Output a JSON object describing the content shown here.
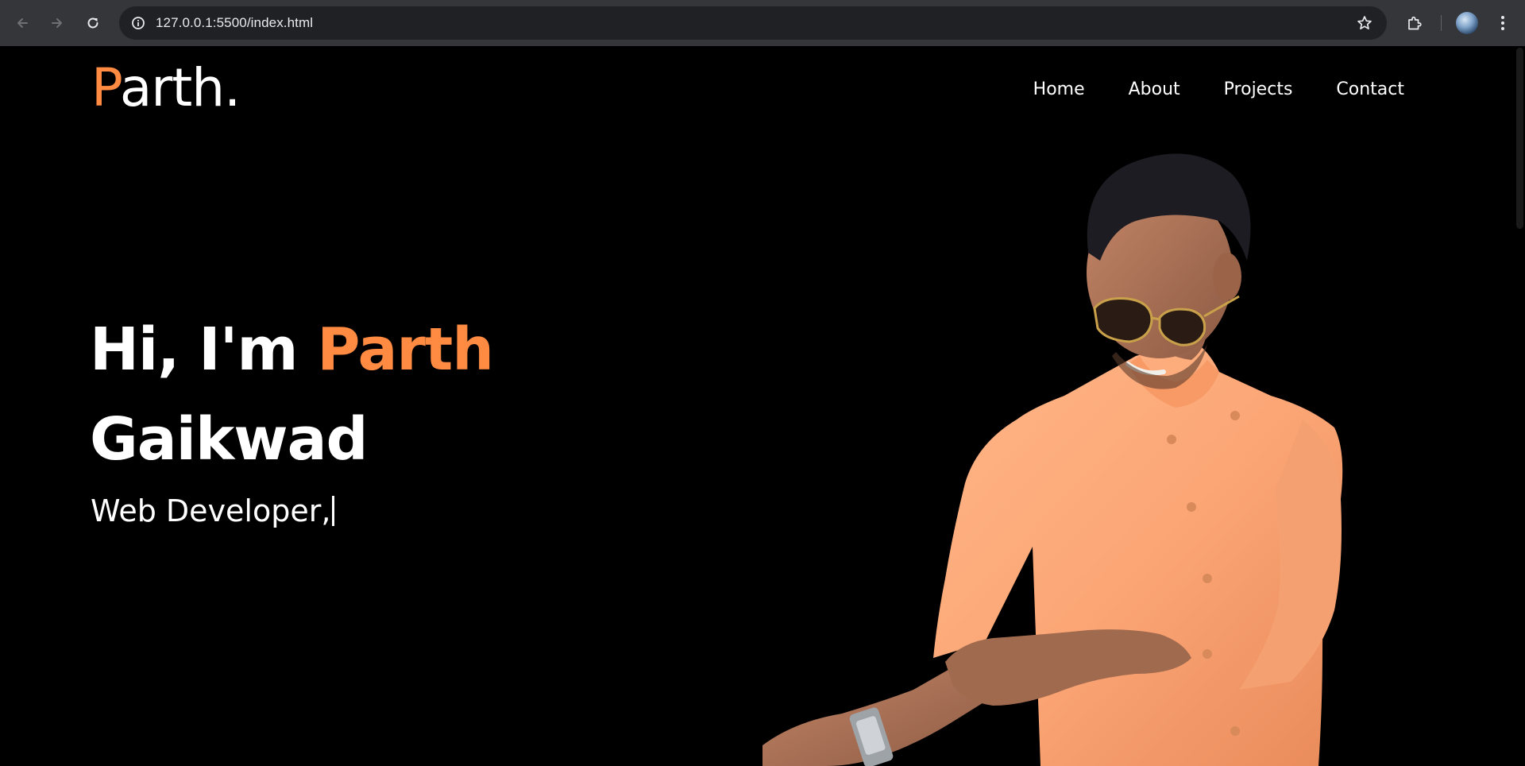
{
  "browser": {
    "url": "127.0.0.1:5500/index.html",
    "icons": {
      "back": "arrow-left-icon",
      "forward": "arrow-right-icon",
      "reload": "reload-icon",
      "site_info": "info-icon",
      "bookmark": "star-icon",
      "extensions": "puzzle-icon",
      "menu": "kebab-menu-icon"
    }
  },
  "site": {
    "logo_first": "P",
    "logo_rest": "arth.",
    "nav": [
      {
        "label": "Home"
      },
      {
        "label": "About"
      },
      {
        "label": "Projects"
      },
      {
        "label": "Contact"
      }
    ],
    "hero": {
      "greeting": "Hi, I'm ",
      "first_name": "Parth",
      "last_name": "Gaikwad",
      "role": "Web Developer,"
    },
    "colors": {
      "accent": "#ff8a42",
      "background": "#000000",
      "text": "#ffffff"
    }
  }
}
